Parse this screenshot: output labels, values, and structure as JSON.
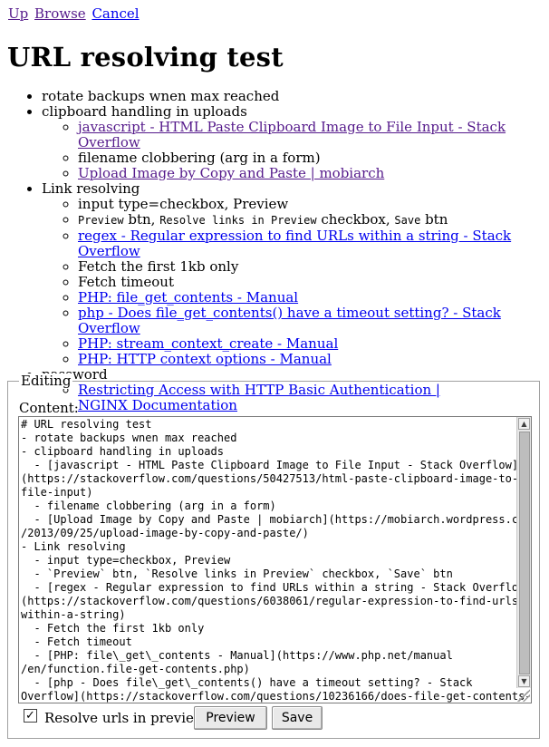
{
  "nav": {
    "up": "Up",
    "browse": "Browse",
    "cancel": "Cancel"
  },
  "page_title": "URL resolving test",
  "list": {
    "item1": "rotate backups wnen max reached",
    "item2": "clipboard handling in uploads",
    "item2_sub": {
      "link1": "javascript - HTML Paste Clipboard Image to File Input - Stack Overflow",
      "text2": "filename clobbering (arg in a form)",
      "link3": "Upload Image by Copy and Paste | mobiarch"
    },
    "item3": "Link resolving",
    "item3_sub": {
      "text1": "input type=checkbox, Preview",
      "t2_code1": "Preview",
      "t2_a": " btn, ",
      "t2_code2": "Resolve links in Preview",
      "t2_b": " checkbox, ",
      "t2_code3": "Save",
      "t2_c": " btn",
      "link3": "regex - Regular expression to find URLs within a string - Stack Overflow",
      "text4": "Fetch the first 1kb only",
      "text5": "Fetch timeout",
      "link6": "PHP: file_get_contents - Manual",
      "link7": "php - Does file_get_contents() have a timeout setting? - Stack Overflow",
      "link8": "PHP: stream_context_create - Manual",
      "link9": "PHP: HTTP context options - Manual"
    },
    "item4": "password",
    "item4_sub": {
      "link1": "Restricting Access with HTTP Basic Authentication | NGINX Documentation"
    }
  },
  "editor": {
    "legend": "Editing",
    "content_label": "Content:",
    "content": "# URL resolving test\n- rotate backups wnen max reached\n- clipboard handling in uploads\n  - [javascript - HTML Paste Clipboard Image to File Input - Stack Overflow]\n(https://stackoverflow.com/questions/50427513/html-paste-clipboard-image-to-\nfile-input)\n  - filename clobbering (arg in a form)\n  - [Upload Image by Copy and Paste | mobiarch](https://mobiarch.wordpress.com\n/2013/09/25/upload-image-by-copy-and-paste/)\n- Link resolving\n  - input type=checkbox, Preview\n  - `Preview` btn, `Resolve links in Preview` checkbox, `Save` btn\n  - [regex - Regular expression to find URLs within a string - Stack Overflow]\n(https://stackoverflow.com/questions/6038061/regular-expression-to-find-urls-\nwithin-a-string)\n  - Fetch the first 1kb only\n  - Fetch timeout\n  - [PHP: file\\_get\\_contents - Manual](https://www.php.net/manual\n/en/function.file-get-contents.php)\n  - [php - Does file\\_get\\_contents() have a timeout setting? - Stack\nOverflow](https://stackoverflow.com/questions/10236166/does-file-get-contents-",
    "checkbox_label": "Resolve urls in preview",
    "checkbox_checked": true,
    "checkbox_mark": "✓",
    "preview_button": "Preview",
    "save_button": "Save"
  }
}
